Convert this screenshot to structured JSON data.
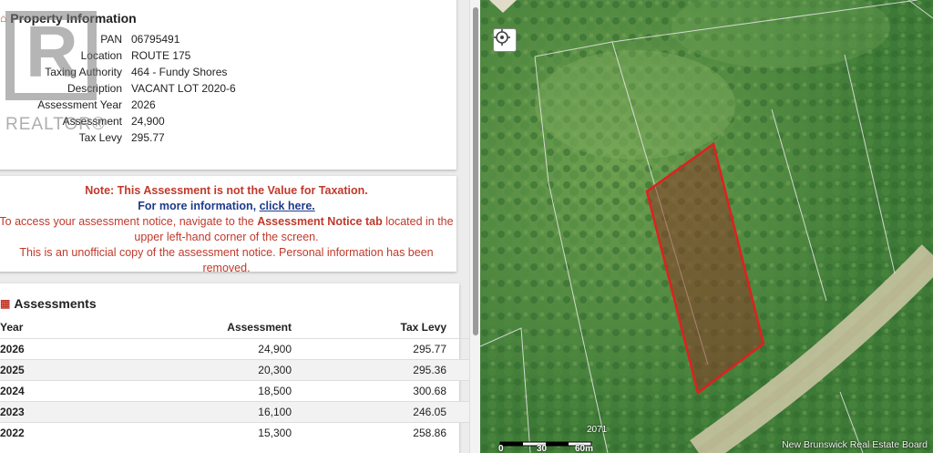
{
  "property_info": {
    "title": "Property Information",
    "fields": [
      {
        "key": "PAN",
        "value": "06795491"
      },
      {
        "key": "Location",
        "value": "ROUTE 175"
      },
      {
        "key": "Taxing Authority",
        "value": "464 - Fundy Shores"
      },
      {
        "key": "Description",
        "value": "VACANT LOT 2020-6"
      },
      {
        "key": "Assessment Year",
        "value": "2026"
      },
      {
        "key": "Assessment",
        "value": "24,900"
      },
      {
        "key": "Tax Levy",
        "value": "295.77"
      }
    ]
  },
  "notice": {
    "line1": "Note: This Assessment is not the Value for Taxation.",
    "line2_prefix": "For more information, ",
    "line2_link": "click here.",
    "line3_prefix": "To access your assessment notice, navigate to the ",
    "line3_bold": "Assessment Notice tab",
    "line3_suffix": " located in the",
    "line4": "upper left-hand corner of the screen.",
    "line5": "This is an unofficial copy of the assessment notice. Personal information has been removed."
  },
  "assessments": {
    "title": "Assessments",
    "headers": {
      "year": "Year",
      "assessment": "Assessment",
      "tax_levy": "Tax Levy"
    },
    "rows": [
      {
        "year": "2026",
        "assessment": "24,900",
        "tax_levy": "295.77"
      },
      {
        "year": "2025",
        "assessment": "20,300",
        "tax_levy": "295.36"
      },
      {
        "year": "2024",
        "assessment": "18,500",
        "tax_levy": "300.68"
      },
      {
        "year": "2023",
        "assessment": "16,100",
        "tax_levy": "246.05"
      },
      {
        "year": "2022",
        "assessment": "15,300",
        "tax_levy": "258.86"
      }
    ]
  },
  "map": {
    "parcel_label": "2071",
    "scale_labels": [
      "0",
      "30",
      "60m"
    ],
    "credit": "New Brunswick Real Estate Board",
    "parcel_color": "#e02020",
    "icons": [
      "recenter-icon"
    ]
  },
  "watermark": {
    "text": "REALTOR®"
  }
}
